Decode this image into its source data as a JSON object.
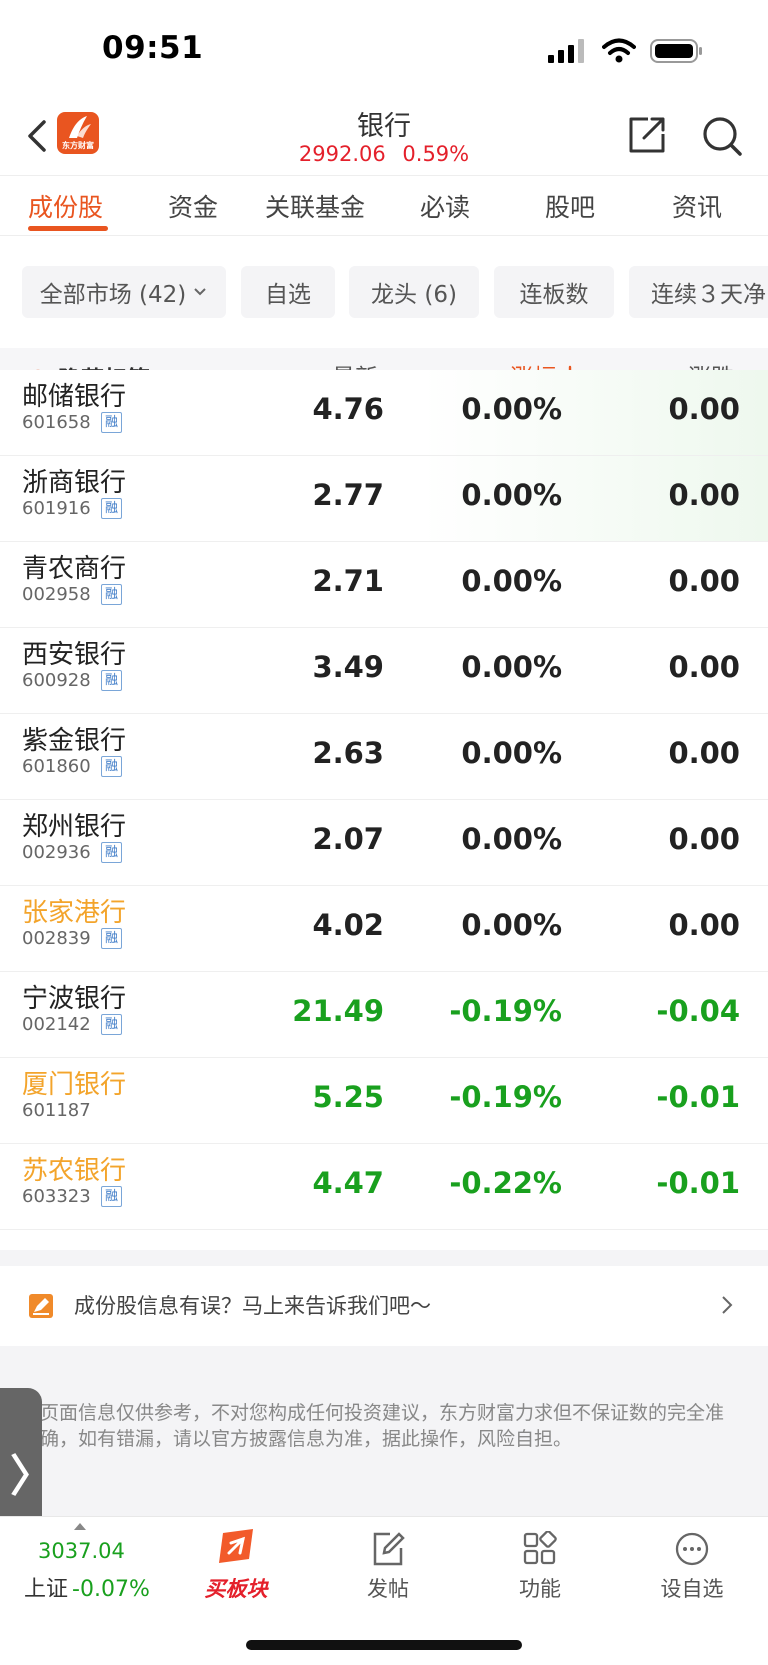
{
  "status_bar": {
    "time": "09:51"
  },
  "header": {
    "title": "银行",
    "price": "2992.06",
    "change_pct": "0.59%",
    "logo_text": "东方财富"
  },
  "tabs": [
    {
      "label": "成份股",
      "active": true
    },
    {
      "label": "资金"
    },
    {
      "label": "关联基金"
    },
    {
      "label": "必读"
    },
    {
      "label": "股吧"
    },
    {
      "label": "资讯"
    }
  ],
  "filters": [
    "全部市场 (42)",
    "自选",
    "龙头 (6)",
    "连板数",
    "连续３天净"
  ],
  "columns": {
    "hide_tags": "隐藏标签",
    "latest": "最新",
    "change_pct": "涨幅",
    "change": "涨跌"
  },
  "rong_label": "融",
  "stocks": [
    {
      "name": "邮储银行",
      "code": "601658",
      "rong": true,
      "latest": "4.76",
      "pct": "0.00%",
      "chg": "0.00",
      "trend": "flat",
      "name_color": "default"
    },
    {
      "name": "浙商银行",
      "code": "601916",
      "rong": true,
      "latest": "2.77",
      "pct": "0.00%",
      "chg": "0.00",
      "trend": "flat",
      "name_color": "default"
    },
    {
      "name": "青农商行",
      "code": "002958",
      "rong": true,
      "latest": "2.71",
      "pct": "0.00%",
      "chg": "0.00",
      "trend": "flat",
      "name_color": "default"
    },
    {
      "name": "西安银行",
      "code": "600928",
      "rong": true,
      "latest": "3.49",
      "pct": "0.00%",
      "chg": "0.00",
      "trend": "flat",
      "name_color": "default"
    },
    {
      "name": "紫金银行",
      "code": "601860",
      "rong": true,
      "latest": "2.63",
      "pct": "0.00%",
      "chg": "0.00",
      "trend": "flat",
      "name_color": "default"
    },
    {
      "name": "郑州银行",
      "code": "002936",
      "rong": true,
      "latest": "2.07",
      "pct": "0.00%",
      "chg": "0.00",
      "trend": "flat",
      "name_color": "default"
    },
    {
      "name": "张家港行",
      "code": "002839",
      "rong": true,
      "latest": "4.02",
      "pct": "0.00%",
      "chg": "0.00",
      "trend": "flat",
      "name_color": "orange"
    },
    {
      "name": "宁波银行",
      "code": "002142",
      "rong": true,
      "latest": "21.49",
      "pct": "-0.19%",
      "chg": "-0.04",
      "trend": "down",
      "name_color": "default"
    },
    {
      "name": "厦门银行",
      "code": "601187",
      "rong": false,
      "latest": "5.25",
      "pct": "-0.19%",
      "chg": "-0.01",
      "trend": "down",
      "name_color": "orange"
    },
    {
      "name": "苏农银行",
      "code": "603323",
      "rong": true,
      "latest": "4.47",
      "pct": "-0.22%",
      "chg": "-0.01",
      "trend": "down",
      "name_color": "orange"
    }
  ],
  "feedback": {
    "text": "成份股信息有误？马上来告诉我们吧～"
  },
  "disclaimer": "页面信息仅供参考，不对您构成任何投资建议，东方财富力求但不保证数的完全准确，如有错漏，请以官方披露信息为准，据此操作，风险自担。",
  "bottom_nav": {
    "index_value": "3037.04",
    "index_name": "上证",
    "index_change": "-0.07%",
    "items": [
      {
        "label": "买板块",
        "icon": "buy-sector-icon"
      },
      {
        "label": "发帖",
        "icon": "post-icon"
      },
      {
        "label": "功能",
        "icon": "functions-icon"
      },
      {
        "label": "设自选",
        "icon": "add-watchlist-icon"
      }
    ]
  },
  "colors": {
    "brand": "#e95520",
    "up": "#e4202b",
    "down": "#19a01e",
    "orange_name": "#f3a42b"
  }
}
